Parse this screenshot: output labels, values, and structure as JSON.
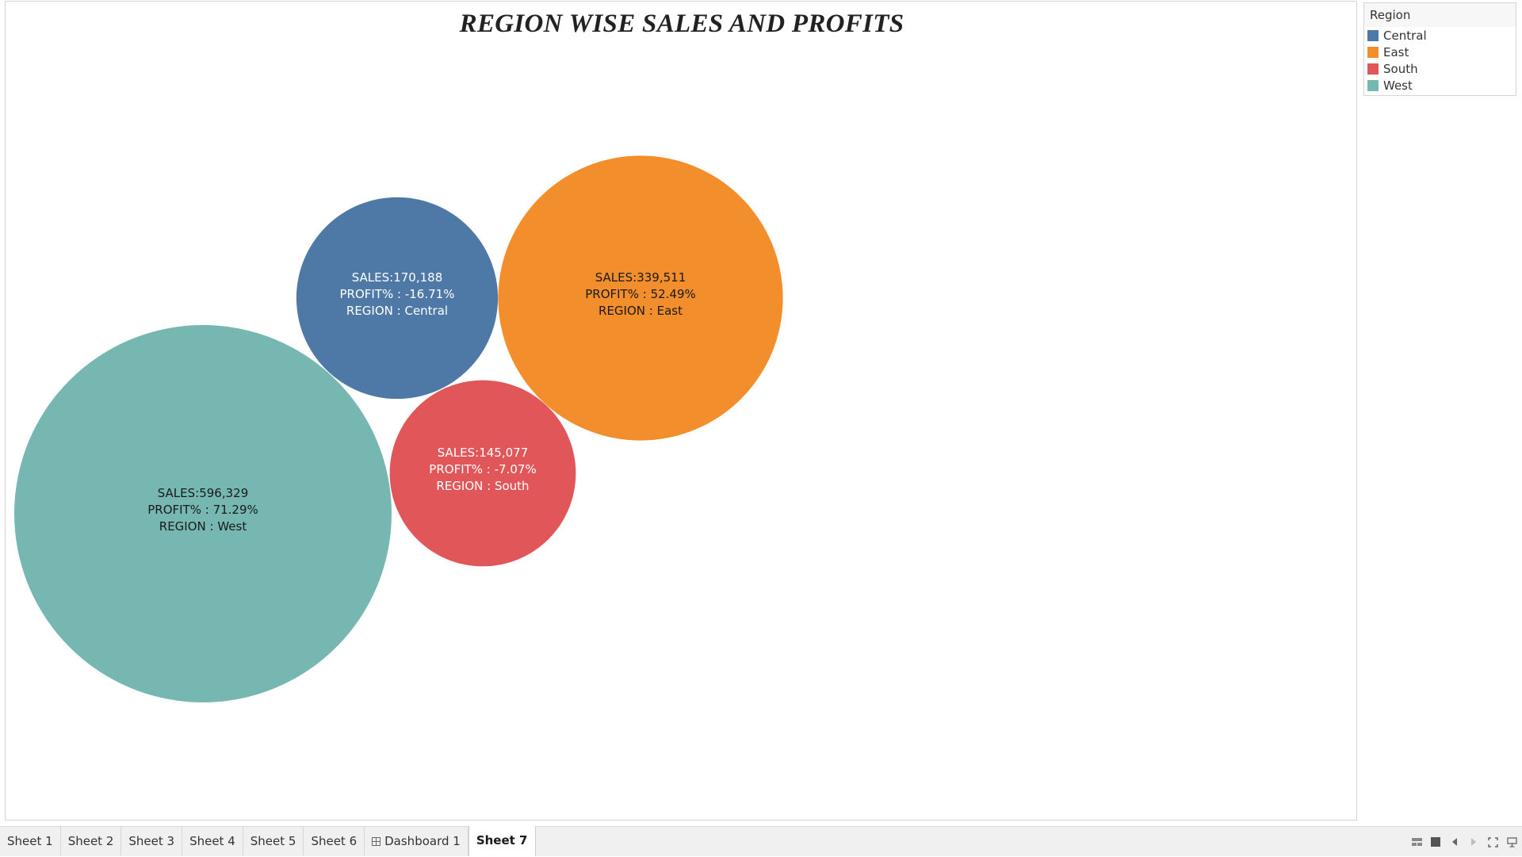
{
  "title": "REGION WISE SALES AND PROFITS",
  "legend": {
    "title": "Region",
    "items": [
      {
        "label": "Central",
        "color": "#4e79a7"
      },
      {
        "label": "East",
        "color": "#f28e2b"
      },
      {
        "label": "South",
        "color": "#e15759"
      },
      {
        "label": "West",
        "color": "#76b7b2"
      }
    ]
  },
  "chart_data": {
    "type": "bubble",
    "title": "REGION WISE SALES AND PROFITS",
    "series": [
      {
        "region": "Central",
        "sales": 170188,
        "profit_pct": -16.71,
        "color": "#4e79a7",
        "label_color": "#ffffff",
        "lines": [
          "SALES:170,188",
          "PROFIT% : -16.71%",
          "REGION : Central"
        ]
      },
      {
        "region": "East",
        "sales": 339511,
        "profit_pct": 52.49,
        "color": "#f28e2b",
        "label_color": "#1a1a1a",
        "lines": [
          "SALES:339,511",
          "PROFIT% : 52.49%",
          "REGION : East"
        ]
      },
      {
        "region": "South",
        "sales": 145077,
        "profit_pct": -7.07,
        "color": "#e15759",
        "label_color": "#ffffff",
        "lines": [
          "SALES:145,077",
          "PROFIT% : -7.07%",
          "REGION : South"
        ]
      },
      {
        "region": "West",
        "sales": 596329,
        "profit_pct": 71.29,
        "color": "#76b7b2",
        "label_color": "#1a1a1a",
        "lines": [
          "SALES:596,329",
          "PROFIT% : 71.29%",
          "REGION : West"
        ]
      }
    ]
  },
  "tabs": [
    {
      "label": "Sheet 1",
      "active": false,
      "icon": ""
    },
    {
      "label": "Sheet 2",
      "active": false,
      "icon": ""
    },
    {
      "label": "Sheet 3",
      "active": false,
      "icon": ""
    },
    {
      "label": "Sheet 4",
      "active": false,
      "icon": ""
    },
    {
      "label": "Sheet 5",
      "active": false,
      "icon": ""
    },
    {
      "label": "Sheet 6",
      "active": false,
      "icon": ""
    },
    {
      "label": "Dashboard 1",
      "active": false,
      "icon": "dashboard-grid-icon"
    },
    {
      "label": "Sheet 7",
      "active": true,
      "icon": ""
    }
  ],
  "status_icons": [
    "show-sheet-sorter-icon",
    "show-filmstrip-icon",
    "prev-sheet-icon",
    "next-sheet-icon",
    "fullscreen-icon",
    "presentation-icon"
  ]
}
